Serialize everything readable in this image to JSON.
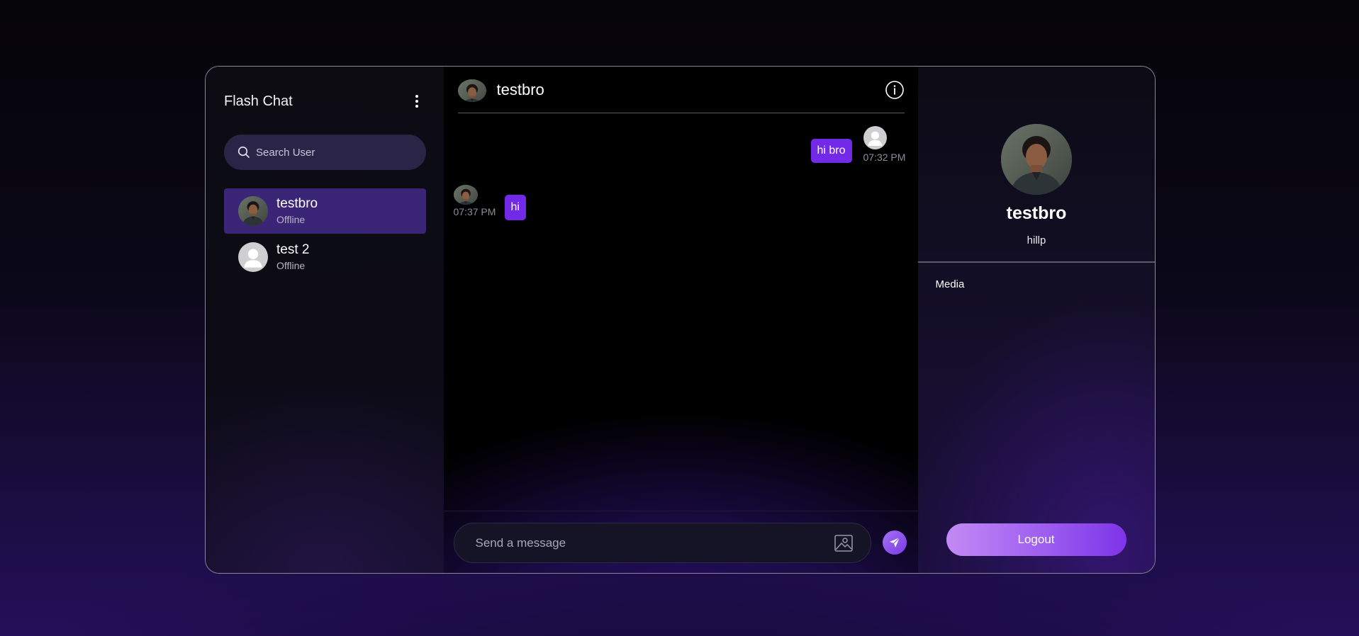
{
  "sidebar": {
    "title": "Flash Chat",
    "search_placeholder": "Search User",
    "users": [
      {
        "name": "testbro",
        "status": "Offline",
        "avatar": "photo",
        "active": true
      },
      {
        "name": "test 2",
        "status": "Offline",
        "avatar": "default",
        "active": false
      }
    ]
  },
  "chat": {
    "header_name": "testbro",
    "messages": [
      {
        "direction": "sent",
        "text": "hi bro",
        "time": "07:32 PM"
      },
      {
        "direction": "received",
        "text": "hi",
        "time": "07:37 PM"
      }
    ],
    "input_placeholder": "Send a message"
  },
  "profile": {
    "name": "testbro",
    "bio": "hillp",
    "media_label": "Media",
    "logout_label": "Logout"
  },
  "colors": {
    "accent": "#7329e8",
    "active_item": "#3a2577",
    "search_bg": "#2a2546"
  },
  "icons": [
    "menu-dots-icon",
    "search-icon",
    "info-icon",
    "image-icon",
    "send-icon",
    "default-avatar-icon"
  ]
}
